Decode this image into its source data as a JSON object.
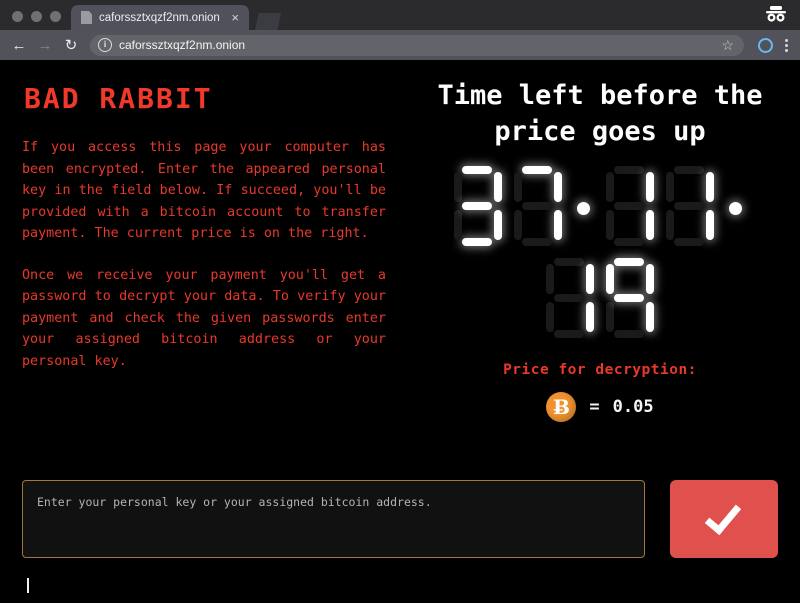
{
  "browser": {
    "tab": {
      "title": "caforssztxqzf2nm.onion",
      "close_label": "×",
      "favicon_name": "page-favicon"
    },
    "toolbar": {
      "back_label": "←",
      "forward_label": "→",
      "reload_label": "↻",
      "info_label": "i",
      "url": "caforssztxqzf2nm.onion",
      "star_label": "☆",
      "menu_label": "⋮"
    },
    "incognito_icon": "incognito-icon"
  },
  "page": {
    "brand": "BAD RABBIT",
    "paragraphs": [
      "If you access this page your computer has been encrypted. Enter the appeared personal key in the field below. If succeed, you'll be provided with a bitcoin account to transfer payment. The current price is on the right.",
      "Once we receive your payment you'll get a password to decrypt your data. To verify your payment and check the given passwords enter your assigned bitcoin address or your personal key."
    ],
    "timer": {
      "title": "Time left before the price goes up",
      "display": "37:11:19",
      "row1": [
        "3",
        "7",
        ":",
        "1",
        "1",
        ":"
      ],
      "row2": [
        "1",
        "9"
      ],
      "hours": "37",
      "minutes": "11",
      "seconds": "19"
    },
    "price": {
      "label": "Price for decryption:",
      "currency_icon": "bitcoin-icon",
      "currency_symbol": "Ƀ",
      "equals": "=",
      "amount": "0.05"
    },
    "form": {
      "input_placeholder": "Enter your personal key or your assigned bitcoin address.",
      "input_value": "",
      "submit_icon": "checkmark-icon"
    }
  },
  "colors": {
    "background": "#000000",
    "ransom_red": "#e8392b",
    "timer_white": "#ffffff",
    "bitcoin_orange": "#f0922e",
    "submit_red": "#e0504d",
    "input_border": "#a2763c"
  }
}
